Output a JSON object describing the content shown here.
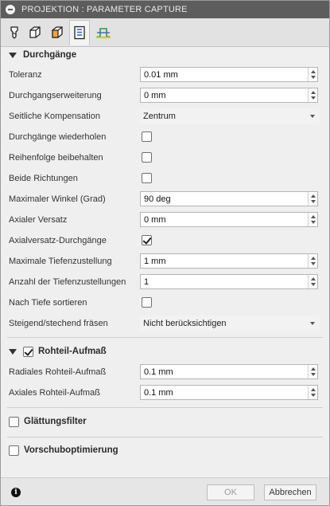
{
  "titlebar": {
    "title": "PROJEKTION : PARAMETER CAPTURE"
  },
  "tabs": [
    {
      "icon": "tool-icon"
    },
    {
      "icon": "geometry-icon"
    },
    {
      "icon": "heights-icon"
    },
    {
      "icon": "passes-icon"
    },
    {
      "icon": "linking-icon"
    }
  ],
  "section_durchgaenge": {
    "title": "Durchgänge"
  },
  "rows": {
    "toleranz": {
      "label": "Toleranz",
      "value": "0.01 mm"
    },
    "durchgangserweiterung": {
      "label": "Durchgangserweiterung",
      "value": "0 mm"
    },
    "seitliche_kompensation": {
      "label": "Seitliche Kompensation",
      "value": "Zentrum"
    },
    "durchgaenge_wiederholen": {
      "label": "Durchgänge wiederholen",
      "checked": false
    },
    "reihenfolge": {
      "label": "Reihenfolge beibehalten",
      "checked": false
    },
    "beide_richtungen": {
      "label": "Beide Richtungen",
      "checked": false
    },
    "max_winkel": {
      "label": "Maximaler Winkel (Grad)",
      "value": "90 deg"
    },
    "axialer_versatz": {
      "label": "Axialer Versatz",
      "value": "0 mm"
    },
    "axialversatz_durchgaenge": {
      "label": "Axialversatz-Durchgänge",
      "checked": true
    },
    "max_tiefenzustellung": {
      "label": "Maximale Tiefenzustellung",
      "value": "1 mm"
    },
    "anzahl_tiefenzustellungen": {
      "label": "Anzahl der Tiefenzustellungen",
      "value": "1"
    },
    "nach_tiefe": {
      "label": "Nach Tiefe sortieren",
      "checked": false
    },
    "steigend": {
      "label": "Steigend/stechend fräsen",
      "value": "Nicht berücksichtigen"
    }
  },
  "section_rohteil": {
    "title": "Rohteil-Aufmaß",
    "checked": true,
    "radiales": {
      "label": "Radiales Rohteil-Aufmaß",
      "value": "0.1 mm"
    },
    "axiales": {
      "label": "Axiales Rohteil-Aufmaß",
      "value": "0.1 mm"
    }
  },
  "section_glaettung": {
    "title": "Glättungsfilter",
    "checked": false
  },
  "section_vorschub": {
    "title": "Vorschuboptimierung",
    "checked": false
  },
  "footer": {
    "ok_label": "OK",
    "cancel_label": "Abbrechen"
  },
  "colors": {
    "titlebar": "#5d5d5d",
    "background": "#efefef",
    "field": "#ffffff"
  }
}
